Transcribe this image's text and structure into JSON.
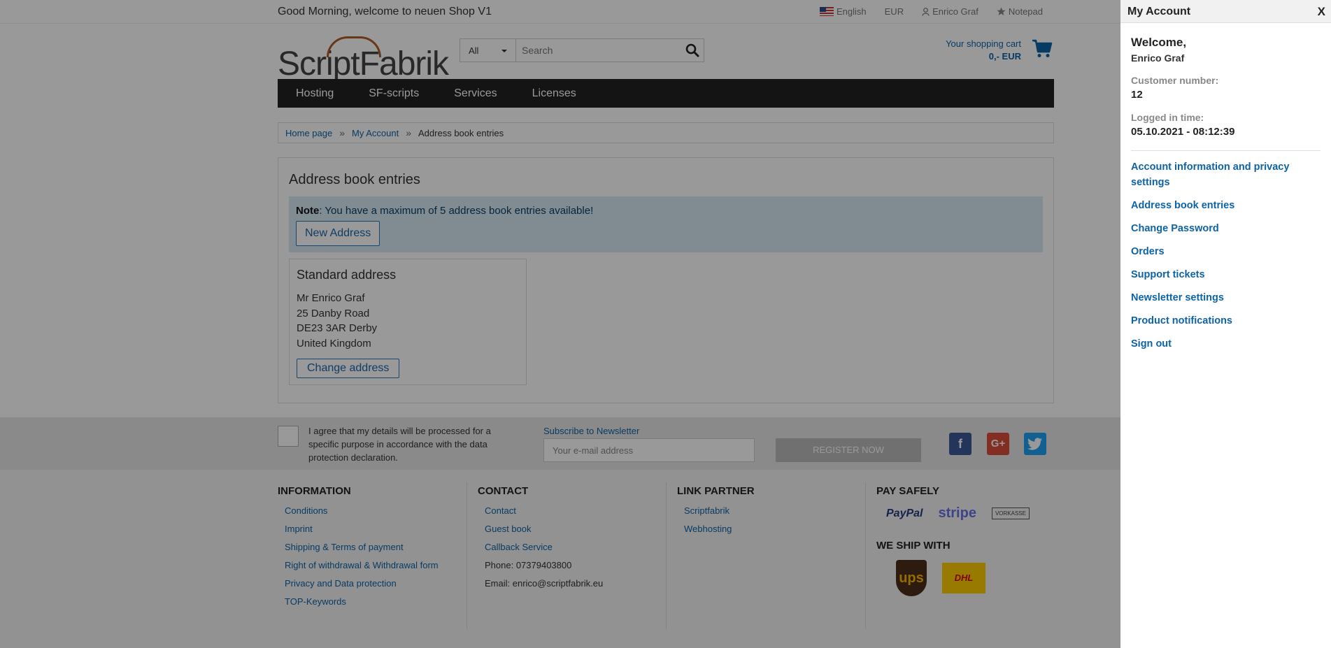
{
  "topbar": {
    "greeting": "Good Morning, welcome to neuen Shop V1",
    "language": "English",
    "currency": "EUR",
    "user": "Enrico Graf",
    "notepad": "Notepad"
  },
  "header": {
    "logo": "ScriptFabrik",
    "search_category": "All",
    "search_placeholder": "Search",
    "cart_label": "Your shopping cart",
    "cart_total": "0,- EUR"
  },
  "nav": [
    "Hosting",
    "SF-scripts",
    "Services",
    "Licenses"
  ],
  "breadcrumb": [
    "Home page",
    "My Account",
    "Address book entries"
  ],
  "content": {
    "title": "Address book entries",
    "note_bold": "Note",
    "note_text": ": You have a maximum of 5 address book entries available!",
    "new_address": "New Address",
    "address_title": "Standard address",
    "address_lines": [
      "Mr Enrico Graf",
      "25 Danby Road",
      "DE23 3AR Derby",
      "United Kingdom"
    ],
    "change_address": "Change address"
  },
  "newsletter": {
    "agree": "I agree that my details will be processed for a specific purpose in accordance with the data protection declaration.",
    "subscribe": "Subscribe to Newsletter",
    "email_placeholder": "Your e-mail address",
    "register": "REGISTER NOW"
  },
  "footer": {
    "information": {
      "title": "INFORMATION",
      "items": [
        "Conditions",
        "Imprint",
        "Shipping & Terms of payment",
        "Right of withdrawal & Withdrawal form",
        "Privacy and Data protection",
        "TOP-Keywords"
      ]
    },
    "contact": {
      "title": "CONTACT",
      "items": [
        "Contact",
        "Guest book",
        "Callback Service"
      ],
      "phone": "Phone: 07379403800",
      "email": "Email: enrico@scriptfabrik.eu"
    },
    "partner": {
      "title": "LINK PARTNER",
      "items": [
        "Scriptfabrik",
        "Webhosting"
      ]
    },
    "pay": {
      "title": "PAY SAFELY",
      "paypal": "PayPal",
      "stripe": "stripe",
      "vorkasse": "VORKASSE"
    },
    "ship": {
      "title": "WE SHIP WITH",
      "ups": "ups",
      "dhl": "DHL"
    }
  },
  "panel": {
    "title": "My Account",
    "close": "X",
    "welcome": "Welcome,",
    "name": "Enrico Graf",
    "customer_label": "Customer number:",
    "customer_number": "12",
    "logged_label": "Logged in time:",
    "logged_time": "05.10.2021 - 08:12:39",
    "menu": [
      "Account information and privacy settings",
      "Address book entries",
      "Change Password",
      "Orders",
      "Support tickets",
      "Newsletter settings",
      "Product notifications",
      "Sign out"
    ]
  },
  "colors": {
    "accent": "#0e63a6",
    "nav_bg": "#222222",
    "note_bg": "#d6eaf4",
    "facebook": "#3b5998",
    "google": "#dd4b39",
    "twitter": "#1da1f2",
    "dhl": "#ffcc00"
  }
}
